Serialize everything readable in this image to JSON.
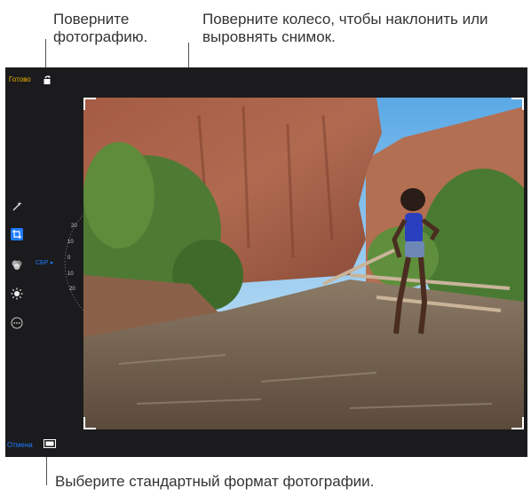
{
  "callouts": {
    "rotate": "Поверните фотографию.",
    "straighten": "Поверните колесо, чтобы наклонить или выровнять снимок.",
    "aspect": "Выберите стандартный формат фотографии."
  },
  "toolbar": {
    "done_label": "Готово",
    "cancel_label": "Отмена"
  },
  "dial": {
    "reset_label": "СБР.",
    "ticks": [
      "20",
      "10",
      "0",
      "10",
      "20"
    ]
  },
  "sidebar": {
    "tools": [
      "magic-wand-icon",
      "crop-icon",
      "color-filters-icon",
      "adjust-light-icon",
      "more-icon"
    ]
  },
  "colors": {
    "done": "#f0b400",
    "cancel": "#1e7cff",
    "reset": "#1e7cff"
  }
}
